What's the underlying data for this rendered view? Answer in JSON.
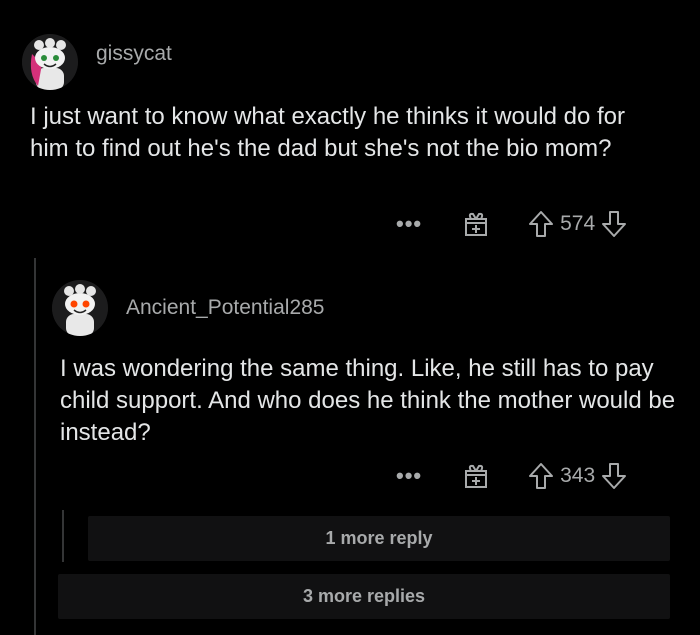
{
  "comments": [
    {
      "username": "gissycat",
      "avatar": "snoo-avatar-pink",
      "body": "I just want to know what exactly he thinks it would do for him to find out he's the dad but she's not the bio mom?",
      "more_icon": "ellipsis-icon",
      "votes": "574"
    },
    {
      "username": "Ancient_Potential285",
      "avatar": "snoo-avatar-default",
      "body": "I was wondering the same thing. Like, he still has to pay child support. And who does he think the mother would be instead?",
      "more_icon": "ellipsis-icon",
      "votes": "343"
    }
  ],
  "more_reply_label": "1 more reply",
  "more_replies_label": "3 more replies",
  "colors": {
    "background": "#000000",
    "text": "#e4e6e7",
    "muted": "#a8aaab",
    "box": "#111112"
  }
}
